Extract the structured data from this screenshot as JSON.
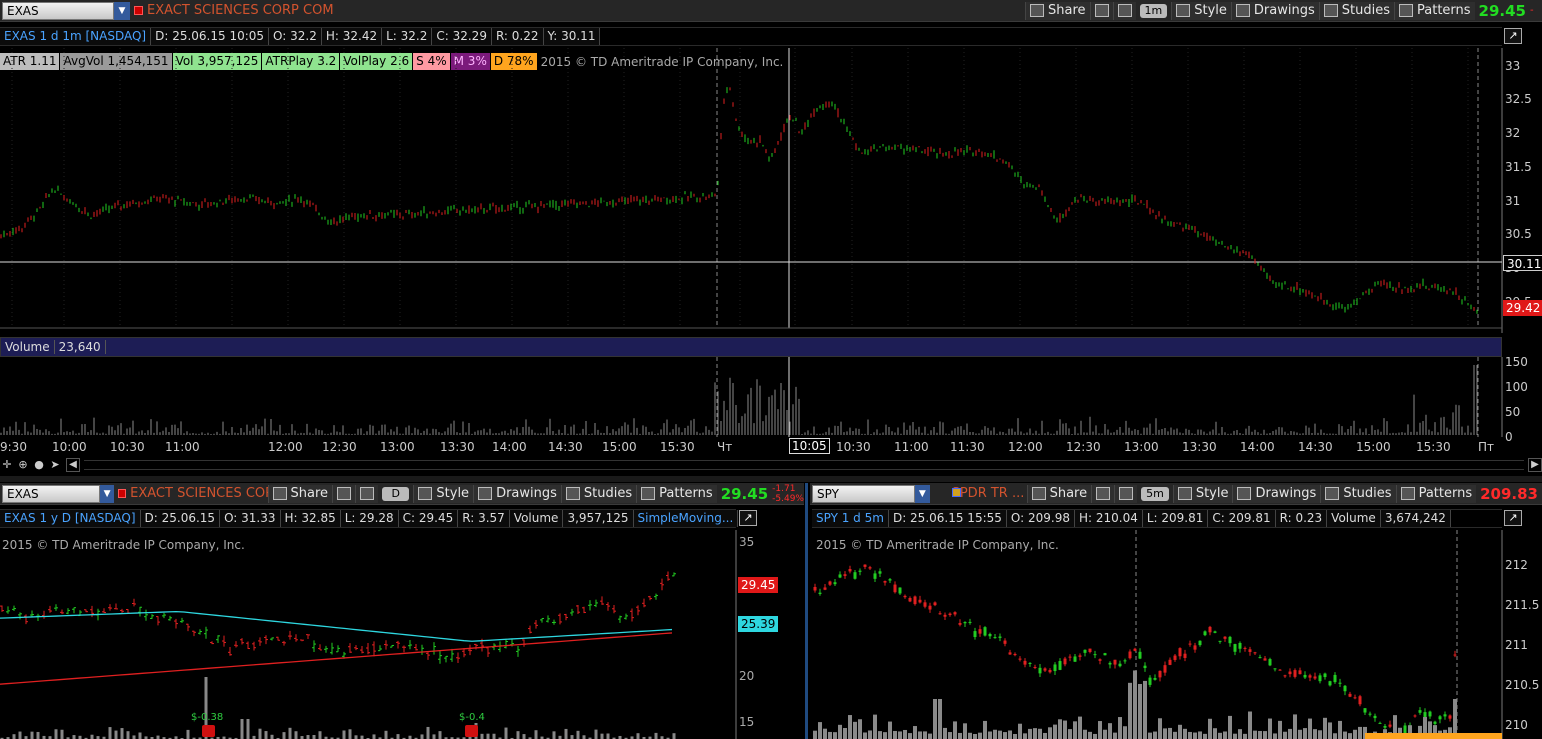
{
  "main": {
    "symbol": "EXAS",
    "company": "EXACT SCIENCES CORP COM",
    "buttons": {
      "share": "Share",
      "style": "Style",
      "drawings": "Drawings",
      "studies": "Studies",
      "patterns": "Patterns"
    },
    "timeframe": "1m",
    "last_price": "29.45",
    "change_partial": "-",
    "info": {
      "symbol_desc": "EXAS 1 d 1m [NASDAQ]",
      "date": "D: 25.06.15 10:05",
      "open": "O: 32.2",
      "high": "H: 32.42",
      "low": "L: 32.2",
      "close": "C: 32.29",
      "range": "R: 0.22",
      "y": "Y: 30.11"
    },
    "chips": [
      {
        "label": "ATR 1.11",
        "bg": "#bdbdbd",
        "fg": "#000"
      },
      {
        "label": "AvgVol 1,454,151",
        "bg": "#9a9a9a",
        "fg": "#000"
      },
      {
        "label": "Vol 3,957,125",
        "bg": "#8fe38f",
        "fg": "#000"
      },
      {
        "label": "ATRPlay 3.2",
        "bg": "#8fe38f",
        "fg": "#000"
      },
      {
        "label": "VolPlay 2.6",
        "bg": "#8fe38f",
        "fg": "#000"
      },
      {
        "label": "S 4%",
        "bg": "#ff9aa2",
        "fg": "#000"
      },
      {
        "label": "M 3%",
        "bg": "#7b1a7b",
        "fg": "#ffb3ff"
      },
      {
        "label": "D 78%",
        "bg": "#ffa51e",
        "fg": "#000"
      }
    ],
    "copyright": "2015 © TD Ameritrade IP Company, Inc.",
    "y_ticks": [
      "33",
      "32.5",
      "32",
      "31.5",
      "31",
      "30.5",
      "30",
      "29.5"
    ],
    "crosshair_price": "30.11",
    "current_price_tag": "29.42",
    "volume_label": "Volume",
    "volume_value": "23,640",
    "vol_ticks": [
      "150",
      "100",
      "50",
      "0"
    ],
    "x_ticks": [
      "9:30",
      "10:00",
      "10:30",
      "11:00",
      "12:00",
      "12:30",
      "13:00",
      "13:30",
      "14:00",
      "14:30",
      "15:00",
      "15:30",
      "Чт",
      "10:05",
      "10:30",
      "11:00",
      "11:30",
      "12:00",
      "12:30",
      "13:00",
      "13:30",
      "14:00",
      "14:30",
      "15:00",
      "15:30",
      "Пт"
    ]
  },
  "left": {
    "symbol": "EXAS",
    "company": "EXACT SCIENCES COR...",
    "timeframe": "D",
    "buttons": {
      "share": "Share",
      "style": "Style",
      "drawings": "Drawings",
      "studies": "Studies",
      "patterns": "Patterns"
    },
    "last_price": "29.45",
    "change": "-1.71",
    "change_pct": "-5.49%",
    "info": {
      "symbol_desc": "EXAS 1 y D [NASDAQ]",
      "date": "D: 25.06.15",
      "open": "O: 31.33",
      "high": "H: 32.85",
      "low": "L: 29.28",
      "close": "C: 29.45",
      "range": "R: 3.57",
      "volume_label": "Volume",
      "volume": "3,957,125",
      "study": "SimpleMoving..."
    },
    "copyright": "2015 © TD Ameritrade IP Company, Inc.",
    "y_ticks": [
      "35",
      "20",
      "15"
    ],
    "price_tag": "29.45",
    "ma_tag": "25.39",
    "events": [
      "$-0.38",
      "$-0.4"
    ]
  },
  "right": {
    "symbol": "SPY",
    "company": "SPDR TR ...",
    "timeframe": "5m",
    "buttons": {
      "share": "Share",
      "style": "Style",
      "drawings": "Drawings",
      "studies": "Studies",
      "patterns": "Patterns"
    },
    "last_price": "209.83",
    "info": {
      "symbol_desc": "SPY 1 d 5m",
      "date": "D: 25.06.15 15:55",
      "open": "O: 209.98",
      "high": "H: 210.04",
      "low": "L: 209.81",
      "close": "C: 209.81",
      "range": "R: 0.23",
      "volume_label": "Volume",
      "volume": "3,674,242"
    },
    "copyright": "2015 © TD Ameritrade IP Company, Inc.",
    "y_ticks": [
      "212",
      "211.5",
      "211",
      "210.5",
      "210"
    ]
  },
  "colors": {
    "up": "#22cc22",
    "down": "#e02020",
    "accent": "#4aa3ff",
    "price_up": "#22dd22",
    "price_down": "#ff2a2a"
  }
}
